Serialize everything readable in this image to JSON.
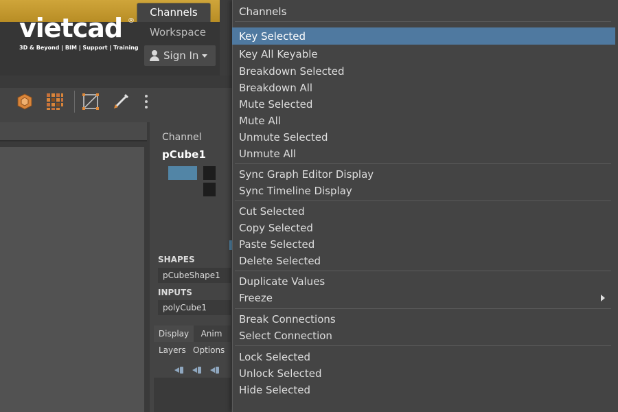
{
  "header": {
    "logo_text": "vietcad",
    "logo_reg": "®",
    "logo_tagline": "3D & Beyond | BIM | Support | Training",
    "tab_channels": "Channels",
    "tab_workspace": "Workspace",
    "signin_label": "Sign In"
  },
  "toolbar": {
    "icons": [
      "cube-icon",
      "grid-icon",
      "select-frame-icon",
      "pen-tool-icon",
      "more-vert-icon"
    ]
  },
  "channel_box": {
    "label": "Channel",
    "object": "pCube1",
    "shapes_header": "SHAPES",
    "shape_item": "pCubeShape1",
    "inputs_header": "INPUTS",
    "input_item": "polyCube1"
  },
  "layer_editor": {
    "tabs": [
      "Display",
      "Anim"
    ],
    "menus": [
      "Layers",
      "Options"
    ]
  },
  "context_menu": {
    "title": "Channels",
    "highlighted": "Key Selected",
    "items": {
      "key_selected": "Key Selected",
      "key_all_keyable": "Key All Keyable",
      "breakdown_selected": "Breakdown Selected",
      "breakdown_all": "Breakdown All",
      "mute_selected": "Mute Selected",
      "mute_all": "Mute All",
      "unmute_selected": "Unmute Selected",
      "unmute_all": "Unmute All",
      "sync_graph_editor": "Sync Graph Editor Display",
      "sync_timeline": "Sync Timeline Display",
      "cut_selected": "Cut Selected",
      "copy_selected": "Copy Selected",
      "paste_selected": "Paste Selected",
      "delete_selected": "Delete Selected",
      "duplicate_values": "Duplicate Values",
      "freeze": "Freeze",
      "break_connections": "Break Connections",
      "select_connection": "Select Connection",
      "lock_selected": "Lock Selected",
      "unlock_selected": "Unlock Selected",
      "hide_selected": "Hide Selected"
    }
  },
  "colors": {
    "highlight": "#4f79a0",
    "brand_gold": "#c29a30",
    "swatch_blue": "#5285a6"
  }
}
